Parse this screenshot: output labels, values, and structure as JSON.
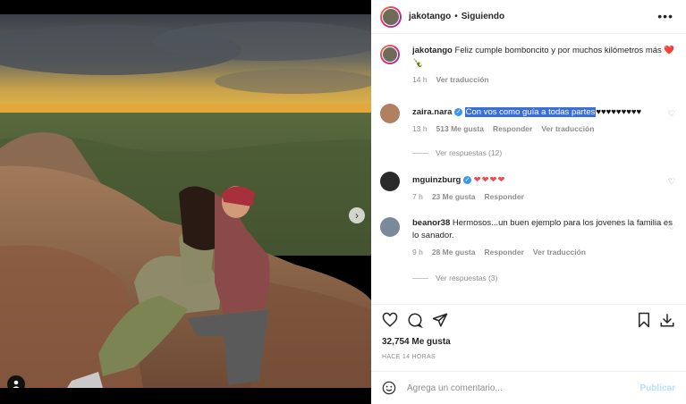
{
  "post": {
    "username": "jakotango",
    "separator": "•",
    "follow_status": "Siguiendo",
    "more_label": "•••"
  },
  "caption": {
    "username": "jakotango",
    "text": "Feliz cumple bomboncito y por muchos kilómetros más",
    "emoji": "❤️🍾",
    "time": "14 h",
    "translate": "Ver traducción"
  },
  "comments": [
    {
      "username": "zaira.nara",
      "verified": true,
      "text_selected": "Con vos como guía a todas partes",
      "text_rest": "♥♥♥♥♥♥♥♥♥",
      "time": "13 h",
      "likes": "513 Me gusta",
      "reply": "Responder",
      "translate": "Ver traducción",
      "replies": "Ver respuestas (12)"
    },
    {
      "username": "mguinzburg",
      "verified": true,
      "text": "❤❤❤❤",
      "time": "7 h",
      "likes": "23 Me gusta",
      "reply": "Responder"
    },
    {
      "username": "beanor38",
      "text": "Hermosos...un buen ejemplo para los jovenes la familia es lo sanador.",
      "time": "9 h",
      "likes": "28 Me gusta",
      "reply": "Responder",
      "translate": "Ver traducción",
      "replies": "Ver respuestas (3)"
    }
  ],
  "stats": {
    "likes": "32,754 Me gusta",
    "posted": "HACE 14 HORAS"
  },
  "composer": {
    "placeholder": "Agrega un comentario...",
    "publish": "Publicar"
  },
  "icons": [
    "heart-icon",
    "comment-icon",
    "share-icon",
    "bookmark-icon",
    "download-icon",
    "emoji-icon",
    "chevron-right-icon",
    "user-tag-icon"
  ],
  "colors": {
    "link_blue": "#3897f0",
    "heart_red": "#ed4956",
    "selection": "#3b6fd8",
    "publish_disabled": "#b2dffc"
  }
}
